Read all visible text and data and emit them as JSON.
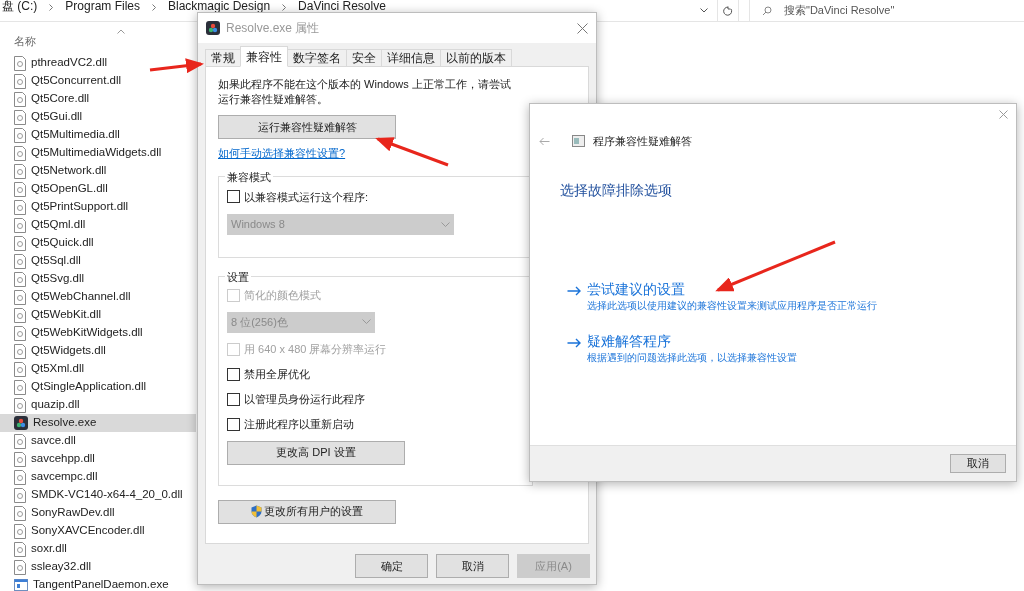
{
  "explorer": {
    "address": [
      "盘 (C:)",
      "Program Files",
      "Blackmagic Design",
      "DaVinci Resolve"
    ],
    "search": {
      "placeholder": "搜索\"DaVinci Resolve\""
    },
    "column": "名称",
    "files": [
      {
        "name": "pthreadVC2.dll",
        "kind": "dll",
        "selected": false
      },
      {
        "name": "Qt5Concurrent.dll",
        "kind": "dll",
        "selected": false
      },
      {
        "name": "Qt5Core.dll",
        "kind": "dll",
        "selected": false
      },
      {
        "name": "Qt5Gui.dll",
        "kind": "dll",
        "selected": false
      },
      {
        "name": "Qt5Multimedia.dll",
        "kind": "dll",
        "selected": false
      },
      {
        "name": "Qt5MultimediaWidgets.dll",
        "kind": "dll",
        "selected": false
      },
      {
        "name": "Qt5Network.dll",
        "kind": "dll",
        "selected": false
      },
      {
        "name": "Qt5OpenGL.dll",
        "kind": "dll",
        "selected": false
      },
      {
        "name": "Qt5PrintSupport.dll",
        "kind": "dll",
        "selected": false
      },
      {
        "name": "Qt5Qml.dll",
        "kind": "dll",
        "selected": false
      },
      {
        "name": "Qt5Quick.dll",
        "kind": "dll",
        "selected": false
      },
      {
        "name": "Qt5Sql.dll",
        "kind": "dll",
        "selected": false
      },
      {
        "name": "Qt5Svg.dll",
        "kind": "dll",
        "selected": false
      },
      {
        "name": "Qt5WebChannel.dll",
        "kind": "dll",
        "selected": false
      },
      {
        "name": "Qt5WebKit.dll",
        "kind": "dll",
        "selected": false
      },
      {
        "name": "Qt5WebKitWidgets.dll",
        "kind": "dll",
        "selected": false
      },
      {
        "name": "Qt5Widgets.dll",
        "kind": "dll",
        "selected": false
      },
      {
        "name": "Qt5Xml.dll",
        "kind": "dll",
        "selected": false
      },
      {
        "name": "QtSingleApplication.dll",
        "kind": "dll",
        "selected": false
      },
      {
        "name": "quazip.dll",
        "kind": "dll",
        "selected": false
      },
      {
        "name": "Resolve.exe",
        "kind": "app",
        "selected": true
      },
      {
        "name": "savce.dll",
        "kind": "dll",
        "selected": false
      },
      {
        "name": "savcehpp.dll",
        "kind": "dll",
        "selected": false
      },
      {
        "name": "savcempc.dll",
        "kind": "dll",
        "selected": false
      },
      {
        "name": "SMDK-VC140-x64-4_20_0.dll",
        "kind": "dll",
        "selected": false
      },
      {
        "name": "SonyRawDev.dll",
        "kind": "dll",
        "selected": false
      },
      {
        "name": "SonyXAVCEncoder.dll",
        "kind": "dll",
        "selected": false
      },
      {
        "name": "soxr.dll",
        "kind": "dll",
        "selected": false
      },
      {
        "name": "ssleay32.dll",
        "kind": "dll",
        "selected": false
      },
      {
        "name": "TangentPanelDaemon.exe",
        "kind": "window",
        "selected": false
      }
    ]
  },
  "properties": {
    "title": "Resolve.exe 属性",
    "tabs": [
      {
        "label": "常规",
        "selected": false
      },
      {
        "label": "兼容性",
        "selected": true
      },
      {
        "label": "数字签名",
        "selected": false
      },
      {
        "label": "安全",
        "selected": false
      },
      {
        "label": "详细信息",
        "selected": false
      },
      {
        "label": "以前的版本",
        "selected": false
      }
    ],
    "intro": "如果此程序不能在这个版本的 Windows 上正常工作，请尝试运行兼容性疑难解答。",
    "troubleshoot_button": "运行兼容性疑难解答",
    "help_link": "如何手动选择兼容性设置?",
    "compat_mode": {
      "legend": "兼容模式",
      "checkbox": {
        "label": "以兼容模式运行这个程序:",
        "checked": false
      },
      "dropdown": {
        "value": "Windows 8",
        "disabled": true
      }
    },
    "settings": {
      "legend": "设置",
      "items": [
        {
          "kind": "checkbox",
          "label": "简化的颜色模式",
          "checked": false,
          "disabled": true
        },
        {
          "kind": "dropdown",
          "value": "8 位(256)色",
          "disabled": true
        },
        {
          "kind": "checkbox",
          "label": "用 640 x 480 屏幕分辨率运行",
          "checked": false,
          "disabled": true
        },
        {
          "kind": "checkbox",
          "label": "禁用全屏优化",
          "checked": false,
          "disabled": false
        },
        {
          "kind": "checkbox",
          "label": "以管理员身份运行此程序",
          "checked": false,
          "disabled": false
        },
        {
          "kind": "checkbox",
          "label": "注册此程序以重新启动",
          "checked": false,
          "disabled": false
        },
        {
          "kind": "button",
          "label": "更改高 DPI 设置"
        }
      ]
    },
    "all_users_button": "更改所有用户的设置",
    "buttons": [
      {
        "label": "确定",
        "disabled": false
      },
      {
        "label": "取消",
        "disabled": false
      },
      {
        "label": "应用(A)",
        "disabled": true
      }
    ]
  },
  "troubleshooter": {
    "title": "程序兼容性疑难解答",
    "heading": "选择故障排除选项",
    "options": [
      {
        "title": "尝试建议的设置",
        "description": "选择此选项以使用建议的兼容性设置来测试应用程序是否正常运行"
      },
      {
        "title": "疑难解答程序",
        "description": "根据遇到的问题选择此选项，以选择兼容性设置"
      }
    ],
    "cancel": "取消"
  }
}
